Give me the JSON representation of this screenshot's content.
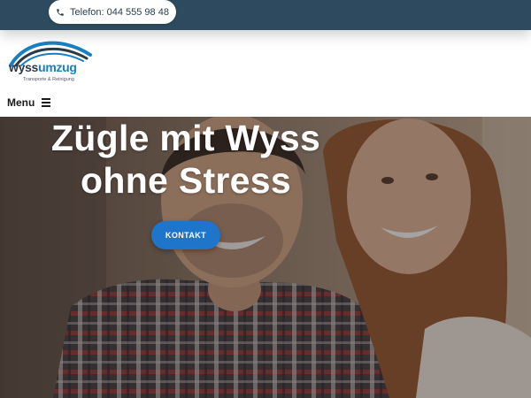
{
  "topbar": {
    "phone_icon": "phone-icon",
    "phone_text": "Telefon: 044 555 98 48"
  },
  "logo": {
    "brand_part1": "wyss",
    "brand_part2": "umzug",
    "tagline": "Transporte & Reinigung",
    "colors": {
      "dark": "#2d3a44",
      "blue": "#1a7fc1"
    }
  },
  "nav": {
    "menu_label": "Menu",
    "menu_icon": "hamburger-icon"
  },
  "hero": {
    "title_line1": "Zügle mit Wyss",
    "title_line2": "ohne Stress",
    "cta_label": "KONTAKT",
    "image": "smiling-couple-photo"
  },
  "colors": {
    "topbar": "#2e4a5e",
    "accent": "#1f75c9",
    "text_dark": "#1b1b1b"
  }
}
